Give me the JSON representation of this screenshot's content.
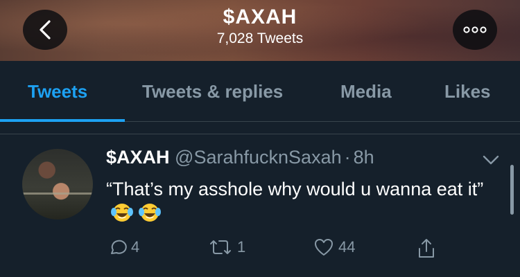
{
  "header": {
    "title": "$AXAH",
    "subtitle": "7,028 Tweets",
    "back_icon": "chevron-left-icon",
    "more_icon": "more-dots-icon"
  },
  "tabs": [
    {
      "label": "Tweets",
      "active": true
    },
    {
      "label": "Tweets & replies",
      "active": false
    },
    {
      "label": "Media",
      "active": false
    },
    {
      "label": "Likes",
      "active": false
    }
  ],
  "tweet": {
    "name": "$AXAH",
    "handle": "@SarahfucknSaxah",
    "separator": "·",
    "time": "8h",
    "text": "“That’s my asshole why would u wanna eat it”",
    "emojis": [
      "face-with-tears-of-joy",
      "face-with-tears-of-joy"
    ],
    "replies": "4",
    "retweets": "1",
    "likes": "44"
  },
  "colors": {
    "background": "#15202b",
    "accent": "#1da1f2",
    "muted": "#8899a6",
    "divider": "#38444d"
  }
}
